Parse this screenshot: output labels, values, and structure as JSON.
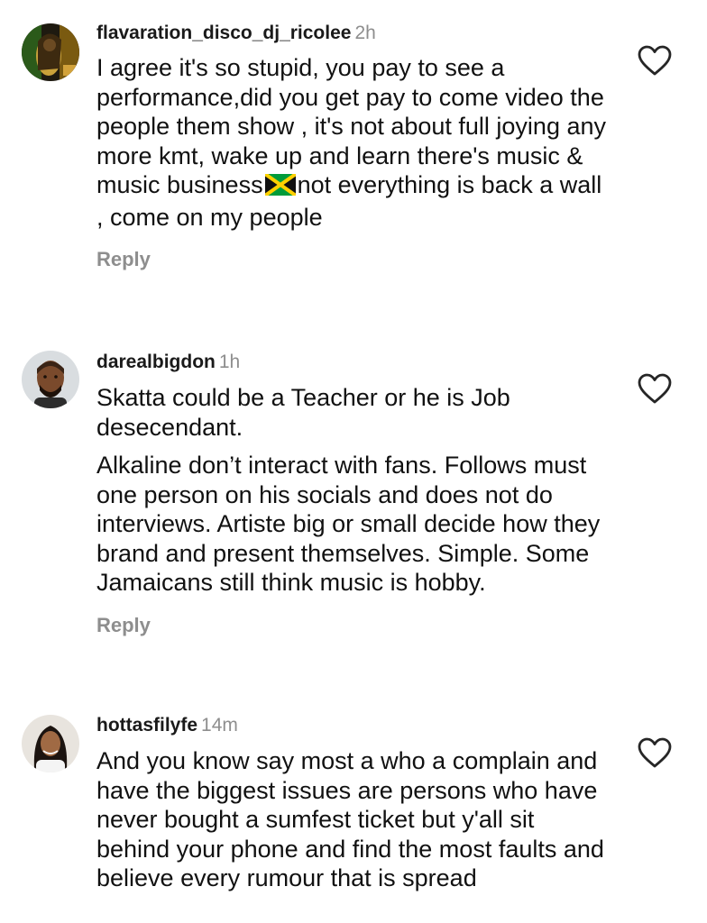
{
  "comments": [
    {
      "username": "flavaration_disco_dj_ricolee",
      "time": "2h",
      "avatar_icon": "rasta-avatar-icon",
      "paragraphs": [
        {
          "before_flag": "I agree it's so stupid, you pay to see a performance,did you get pay to come video the people them show , it's not about full joying any more kmt, wake up and learn there's music & music business",
          "flag": "jamaica-flag-icon",
          "after_flag": "not everything is back a wall , come on my people"
        }
      ],
      "reply_label": "Reply"
    },
    {
      "username": "darealbigdon",
      "time": "1h",
      "avatar_icon": "man-avatar-icon",
      "paragraphs": [
        "Skatta could be a Teacher or he is Job desecendant.",
        "Alkaline don’t interact with fans. Follows must one person on his socials and does not do interviews. Artiste big or small decide how they brand and present themselves. Simple. Some Jamaicans still think music is hobby."
      ],
      "reply_label": "Reply"
    },
    {
      "username": "hottasfilyfe",
      "time": "14m",
      "avatar_icon": "woman-avatar-icon",
      "paragraphs": [
        "And you know say most a who a complain and have the biggest issues are persons who have never bought a sumfest ticket but y'all sit behind your phone and find the most faults and believe every rumour that is spread"
      ]
    }
  ],
  "colors": {
    "text": "#111111",
    "muted": "#8e8e8e",
    "background": "#ffffff"
  }
}
